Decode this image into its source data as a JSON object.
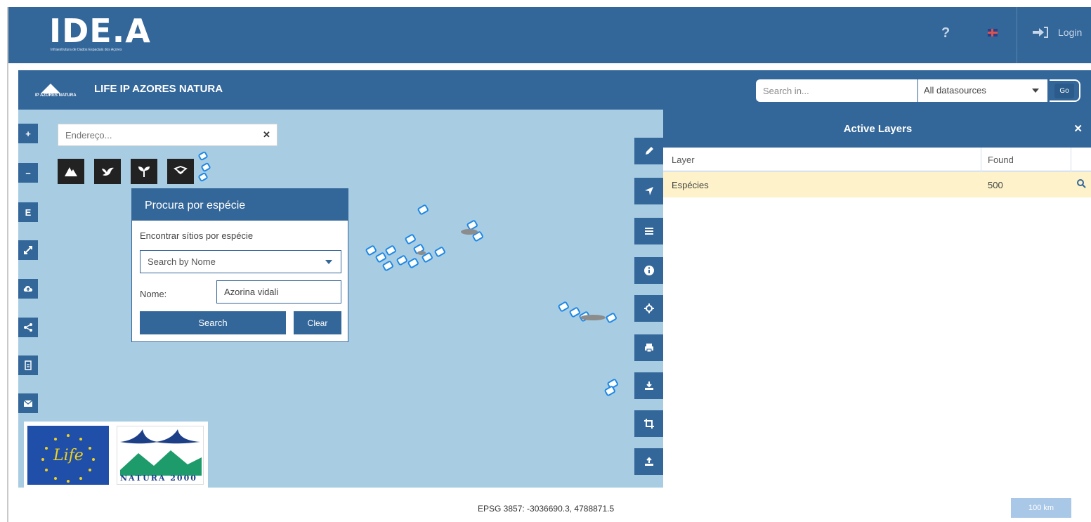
{
  "header": {
    "logo_text": "IDE.A",
    "logo_subtitle": "Infraestrutura de Dados Espaciais dos Açores",
    "help_label": "?",
    "login_label": "Login"
  },
  "subheader": {
    "portal_logo_text": "IP AZORES NATURA",
    "title": "LIFE IP AZORES NATURA",
    "search_placeholder": "Search in...",
    "datasource_selected": "All datasources",
    "go_label": "Go"
  },
  "map": {
    "address_placeholder": "Endereço...",
    "zoom_in_label": "+",
    "zoom_out_label": "−",
    "e_label": "E",
    "species_panel": {
      "title": "Procura por espécie",
      "subtitle": "Encontrar sítios por espécie",
      "search_by_selected": "Search by Nome",
      "name_label": "Nome:",
      "name_value": "Azorina vidali",
      "search_button": "Search",
      "clear_button": "Clear"
    },
    "coordinates": "EPSG 3857: -3036690.3, 4788871.5",
    "scale_label": "100 km",
    "logos": {
      "life_text": "Life",
      "natura_text": "NATURA 2000"
    }
  },
  "active_layers": {
    "title": "Active Layers",
    "columns": [
      "Layer",
      "Found"
    ],
    "rows": [
      {
        "layer": "Espécies",
        "found": "500"
      }
    ]
  },
  "colors": {
    "primary": "#336699",
    "map_water": "#a8cde3",
    "row_highlight": "#fdf2c9"
  }
}
